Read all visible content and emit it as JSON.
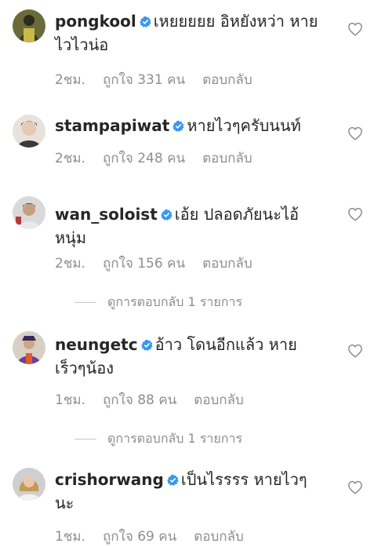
{
  "colors": {
    "text": "#262626",
    "muted": "#8e8e8e",
    "verified": "#3897f0"
  },
  "comments": [
    {
      "username": "pongkool",
      "verified": true,
      "text": "เหยยยยย อิหยังหว่า หายไวไวน่อ",
      "time": "2ชม.",
      "likes": "ถูกใจ 331 คน",
      "reply": "ตอบกลับ",
      "avatar": "avatar-pongkool"
    },
    {
      "username": "stampapiwat",
      "verified": true,
      "text": "หายไวๆครับนนท์",
      "time": "2ชม.",
      "likes": "ถูกใจ 248 คน",
      "reply": "ตอบกลับ",
      "avatar": "avatar-stampapiwat"
    },
    {
      "username": "wan_soloist",
      "verified": true,
      "text": "เอ้ย ปลอดภัยนะไอ้หนุ่ม",
      "time": "2ชม.",
      "likes": "ถูกใจ 156 คน",
      "reply": "ตอบกลับ",
      "view_replies": "ดูการตอบกลับ 1 รายการ",
      "avatar": "avatar-wan-soloist"
    },
    {
      "username": "neungetc",
      "verified": true,
      "text": "อ้าว โดนอีกแล้ว หายเร็วๆน้อง",
      "time": "1ชม.",
      "likes": "ถูกใจ 88 คน",
      "reply": "ตอบกลับ",
      "view_replies": "ดูการตอบกลับ 1 รายการ",
      "avatar": "avatar-neungetc"
    },
    {
      "username": "crishorwang",
      "verified": true,
      "text": "เป็นไรรรร หายไวๆนะ",
      "time": "1ชม.",
      "likes": "ถูกใจ 69 คน",
      "reply": "ตอบกลับ",
      "avatar": "avatar-crishorwang"
    }
  ]
}
